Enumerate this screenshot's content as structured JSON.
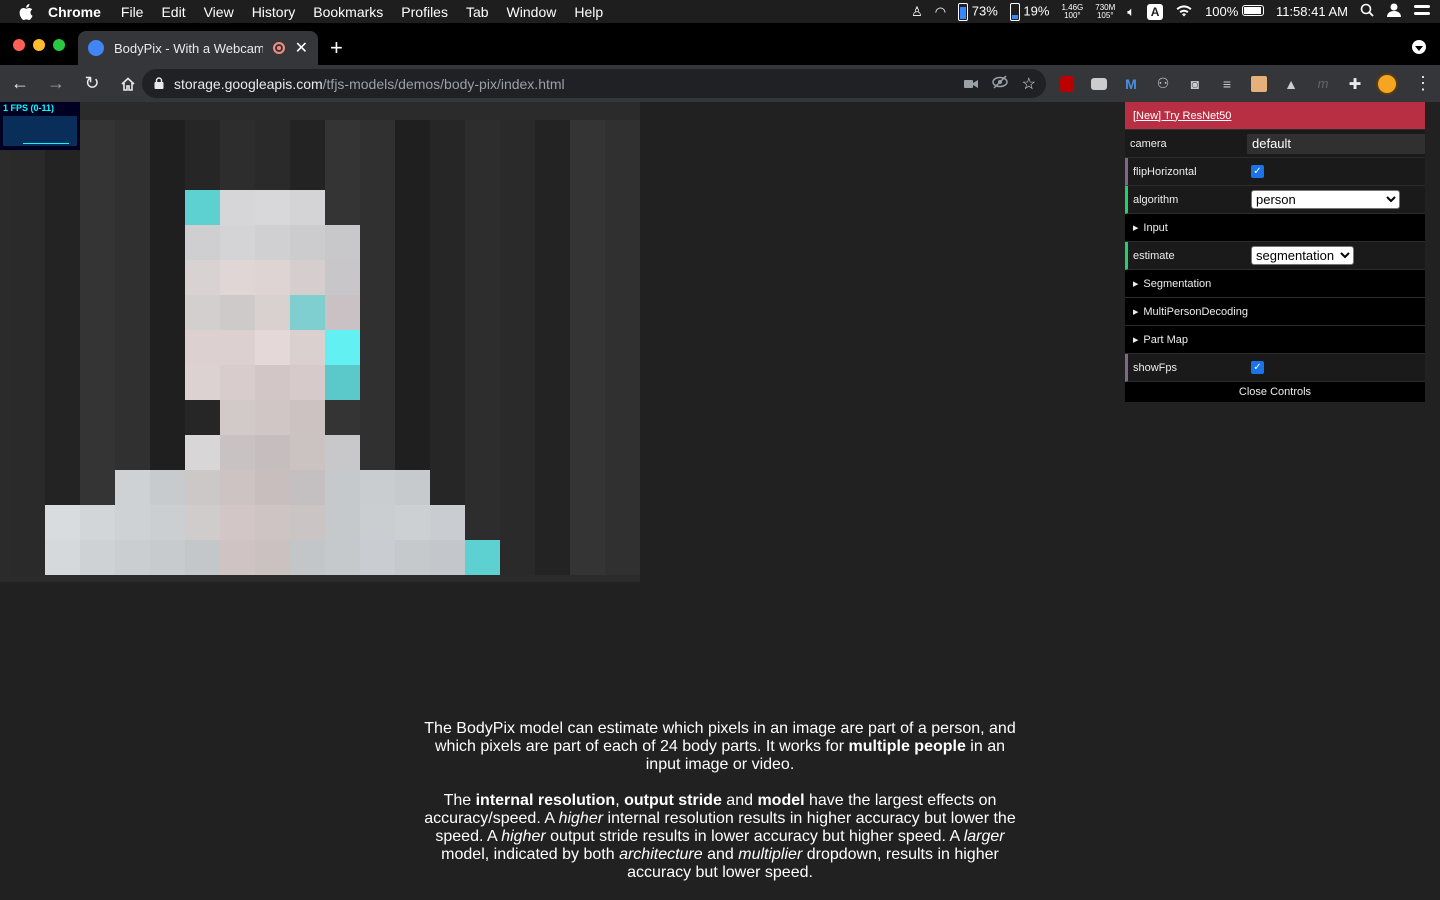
{
  "menubar": {
    "app": "Chrome",
    "items": [
      "File",
      "Edit",
      "View",
      "History",
      "Bookmarks",
      "Profiles",
      "Tab",
      "Window",
      "Help"
    ],
    "status": {
      "cpu_pct": "73%",
      "mem_pct": "19%",
      "net_top": "1.46G",
      "net_bottom": "100°",
      "net2_top": "730M",
      "net2_bottom": "105°",
      "input_source": "A",
      "battery": "100%",
      "clock": "11:58:41 AM"
    }
  },
  "browser": {
    "tab_title": "BodyPix - With a Webcam",
    "url_host": "storage.googleapis.com",
    "url_path": "/tfjs-models/demos/body-pix/index.html"
  },
  "fps_meter": {
    "label": "1 FPS (0-11)"
  },
  "gui": {
    "banner_link": "[New] Try ResNet50",
    "camera_label": "camera",
    "camera_value": "default",
    "flip_label": "flipHorizontal",
    "flip_checked": true,
    "algorithm_label": "algorithm",
    "algorithm_value": "person",
    "input_folder": "Input",
    "estimate_label": "estimate",
    "estimate_value": "segmentation",
    "segmentation_folder": "Segmentation",
    "multiperson_folder": "MultiPersonDecoding",
    "partmap_folder": "Part Map",
    "showfps_label": "showFps",
    "showfps_checked": true,
    "close_label": "Close Controls"
  },
  "description": {
    "p1_a": "The BodyPix model can estimate which pixels in an image are part of a person, and which pixels are part of each of 24 body parts. It works for ",
    "p1_b": "multiple people",
    "p1_c": " in an input image or video.",
    "p2_a": "The ",
    "p2_b": "internal resolution",
    "p2_c": ", ",
    "p2_d": "output stride",
    "p2_e": " and ",
    "p2_f": "model",
    "p2_g": " have the largest effects on accuracy/speed. A ",
    "p2_h": "higher",
    "p2_i": " internal resolution results in higher accuracy but lower the speed. A ",
    "p2_j": "higher",
    "p2_k": " output stride results in lower accuracy but higher speed. A ",
    "p2_l": "larger",
    "p2_m": " model, indicated by both ",
    "p2_n": "architecture",
    "p2_o": " and ",
    "p2_p": "multiplier",
    "p2_q": " dropdown, results in higher accuracy but lower speed."
  },
  "colors": {
    "banner": "#b82f43",
    "string_accent": "#1ed36f",
    "bool_accent": "#806787",
    "segmentation_cyan": "#5dd0d2"
  }
}
